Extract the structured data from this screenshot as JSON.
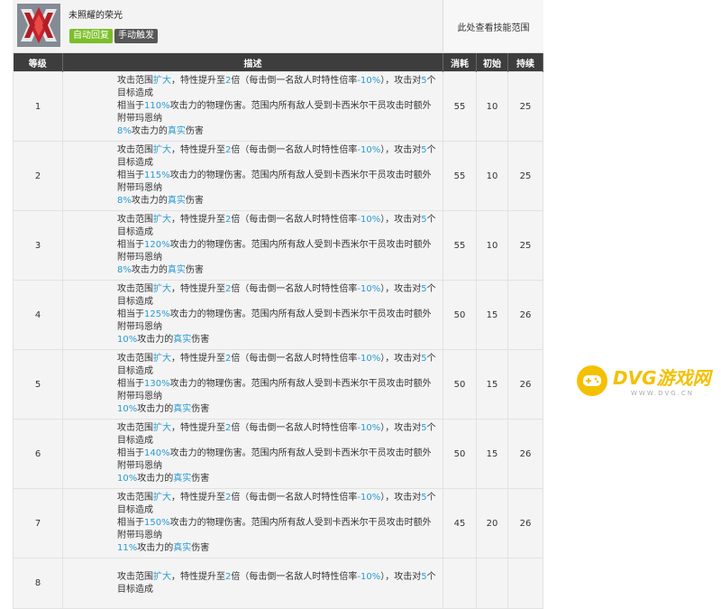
{
  "skill": {
    "name": "未照耀的荣光",
    "tags": [
      "自动回复",
      "手动触发"
    ],
    "range_text": "此处查看技能范围"
  },
  "columns": [
    "等级",
    "描述",
    "消耗",
    "初始",
    "持续"
  ],
  "rows": [
    {
      "level": "1",
      "pct": "110%",
      "atk": "8%",
      "cost": "55",
      "init": "10",
      "dur": "25"
    },
    {
      "level": "2",
      "pct": "115%",
      "atk": "8%",
      "cost": "55",
      "init": "10",
      "dur": "25"
    },
    {
      "level": "3",
      "pct": "120%",
      "atk": "8%",
      "cost": "55",
      "init": "10",
      "dur": "25"
    },
    {
      "level": "4",
      "pct": "125%",
      "atk": "10%",
      "cost": "50",
      "init": "15",
      "dur": "26"
    },
    {
      "level": "5",
      "pct": "130%",
      "atk": "10%",
      "cost": "50",
      "init": "15",
      "dur": "26"
    },
    {
      "level": "6",
      "pct": "140%",
      "atk": "10%",
      "cost": "50",
      "init": "15",
      "dur": "26"
    },
    {
      "level": "7",
      "pct": "150%",
      "atk": "11%",
      "cost": "45",
      "init": "20",
      "dur": "26"
    },
    {
      "level": "8",
      "pct": "",
      "atk": "",
      "cost": "",
      "init": "",
      "dur": ""
    }
  ],
  "desc_parts": {
    "p1": "攻击范围",
    "kw_range": "扩大",
    "p2": "，特性提升至",
    "kw_mult": "2",
    "p3": "倍（每击倒一名敌人时特性倍率",
    "kw_minus": "-10%",
    "p4": "），攻击对",
    "kw_targets": "5",
    "p5": "个目标造成",
    "p6": "相当于",
    "p7": "攻击力的物理伤害。范围内所有敌人受到卡西米尔干员攻击时额外附带玛恩纳",
    "p8": "攻击力的",
    "kw_true": "真实",
    "p9": "伤害"
  },
  "watermark": {
    "main": "DVG游戏网",
    "sub": "WWW.DVG.CN"
  }
}
